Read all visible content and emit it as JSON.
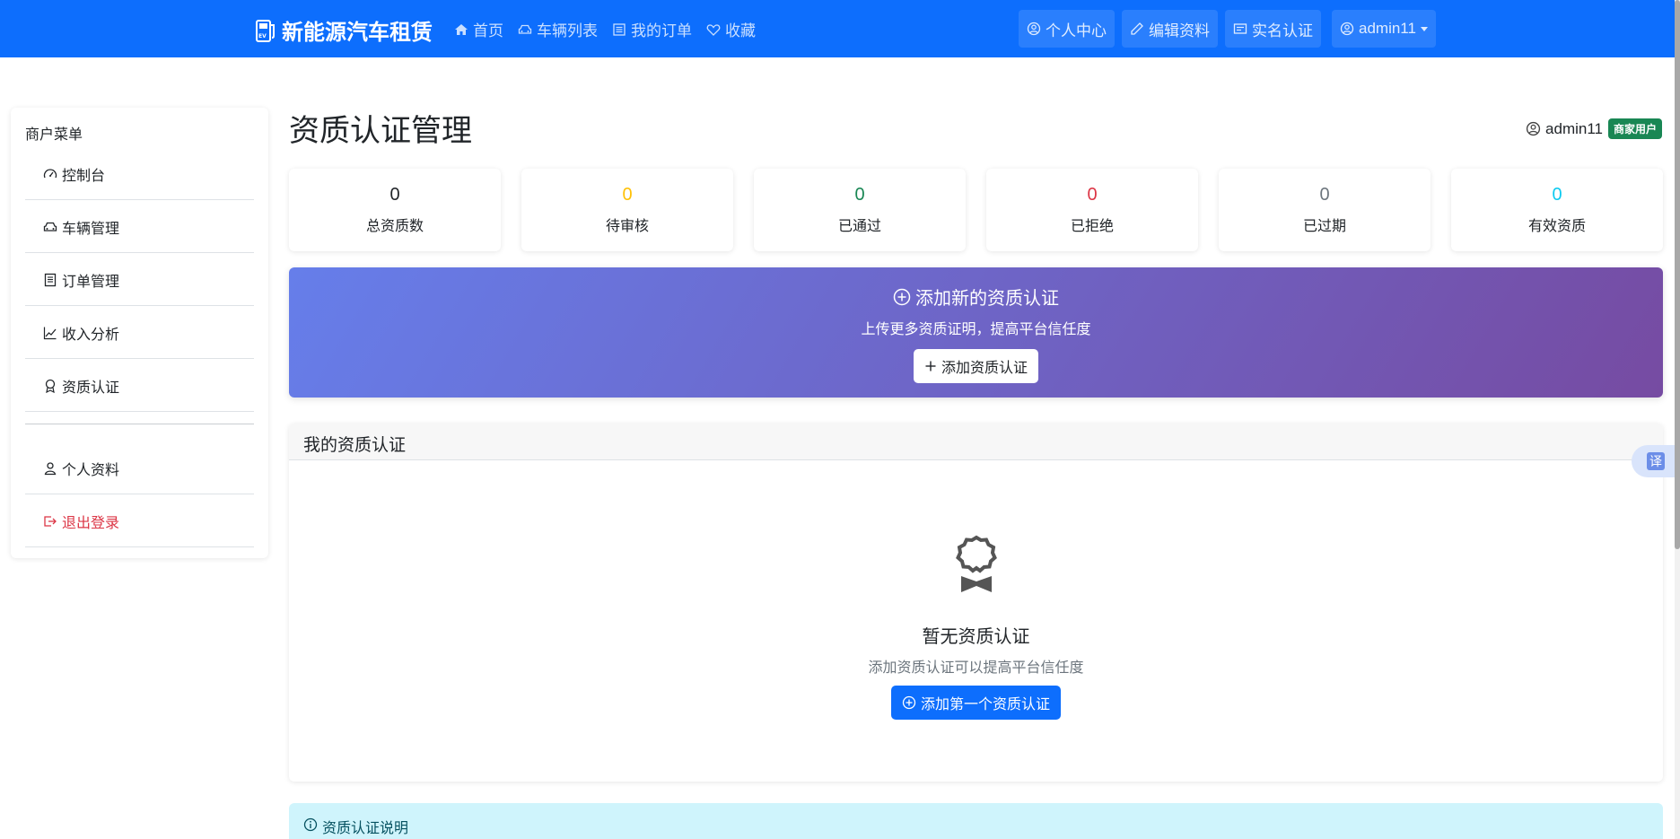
{
  "brand": {
    "name": "新能源汽车租赁",
    "icon": "ev-charger-icon"
  },
  "nav": {
    "links": [
      {
        "label": "首页",
        "icon": "house-icon"
      },
      {
        "label": "车辆列表",
        "icon": "car-icon"
      },
      {
        "label": "我的订单",
        "icon": "list-icon"
      },
      {
        "label": "收藏",
        "icon": "heart-icon"
      }
    ],
    "right": {
      "profile": "个人中心",
      "edit": "编辑资料",
      "verify": "实名认证",
      "user": "admin11"
    }
  },
  "sidebar": {
    "title": "商户菜单",
    "items": [
      {
        "label": "控制台",
        "icon": "speedometer-icon"
      },
      {
        "label": "车辆管理",
        "icon": "car-icon"
      },
      {
        "label": "订单管理",
        "icon": "receipt-icon"
      },
      {
        "label": "收入分析",
        "icon": "chart-line-icon"
      },
      {
        "label": "资质认证",
        "icon": "award-icon"
      }
    ],
    "bottom": [
      {
        "label": "个人资料",
        "icon": "person-icon"
      },
      {
        "label": "退出登录",
        "icon": "logout-icon"
      }
    ]
  },
  "page": {
    "title": "资质认证管理",
    "user": "admin11",
    "role_badge": "商家用户"
  },
  "stats": [
    {
      "value": "0",
      "label": "总资质数",
      "color": "#212529"
    },
    {
      "value": "0",
      "label": "待审核",
      "color": "#ffc107"
    },
    {
      "value": "0",
      "label": "已通过",
      "color": "#198754"
    },
    {
      "value": "0",
      "label": "已拒绝",
      "color": "#dc3545"
    },
    {
      "value": "0",
      "label": "已过期",
      "color": "#6c757d"
    },
    {
      "value": "0",
      "label": "有效资质",
      "color": "#0dcaf0"
    }
  ],
  "banner": {
    "title": "添加新的资质认证",
    "subtitle": "上传更多资质证明，提高平台信任度",
    "button": "添加资质认证"
  },
  "list_card": {
    "header": "我的资质认证",
    "empty_title": "暂无资质认证",
    "empty_subtitle": "添加资质认证可以提高平台信任度",
    "empty_button": "添加第一个资质认证"
  },
  "info": {
    "title": "资质认证说明"
  },
  "translate": {
    "label": "译"
  },
  "colors": {
    "primary": "#0d6efd",
    "success": "#198754",
    "danger": "#dc3545",
    "gradient_start": "#667eea",
    "gradient_end": "#764ba2"
  }
}
